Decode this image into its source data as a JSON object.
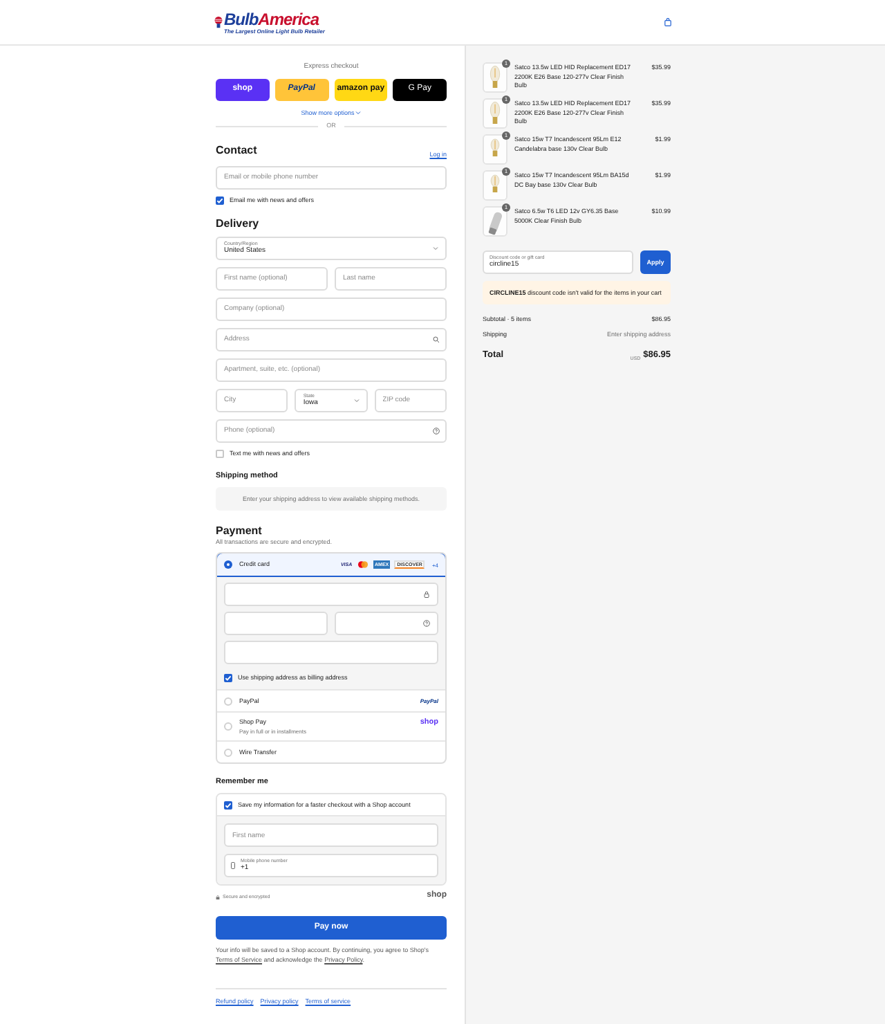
{
  "header": {
    "logo": {
      "part_1": "Bulb",
      "part_2": "America",
      "tagline": "The Largest Online Light Bulb Retailer"
    }
  },
  "express_checkout": {
    "label": "Express checkout",
    "buttons": [
      {
        "kind": "shop",
        "label": "shop"
      },
      {
        "kind": "paypal",
        "label": "PayPal"
      },
      {
        "kind": "amazon",
        "label": "amazon pay"
      },
      {
        "kind": "gpay",
        "label": "G Pay"
      }
    ],
    "more": "Show more options",
    "divider": "OR"
  },
  "contact": {
    "title": "Contact",
    "login": "Log in",
    "email": {
      "placeholder": "Email or mobile phone number"
    },
    "news": {
      "label": "Email me with news and offers",
      "checked": true
    }
  },
  "delivery": {
    "title": "Delivery",
    "country": {
      "label": "Country/Region",
      "value": "United States"
    },
    "first_name": {
      "placeholder": "First name (optional)"
    },
    "last_name": {
      "placeholder": "Last name"
    },
    "company": {
      "placeholder": "Company (optional)"
    },
    "address": {
      "placeholder": "Address"
    },
    "apartment": {
      "placeholder": "Apartment, suite, etc. (optional)"
    },
    "city": {
      "placeholder": "City"
    },
    "state": {
      "label": "State",
      "value": "Iowa"
    },
    "zip": {
      "placeholder": "ZIP code"
    },
    "phone": {
      "placeholder": "Phone (optional)"
    },
    "text_me": {
      "label": "Text me with news and offers",
      "checked": false
    }
  },
  "shipping_method": {
    "title": "Shipping method",
    "message": "Enter your shipping address to view available shipping methods."
  },
  "payment": {
    "title": "Payment",
    "subtitle": "All transactions are secure and encrypted.",
    "methods": [
      {
        "kind": "card",
        "label": "Credit card",
        "selected": true,
        "brands": [
          {
            "kind": "visa",
            "label": "VISA"
          },
          {
            "kind": "mastercard"
          },
          {
            "kind": "amex",
            "label": "AMEX"
          },
          {
            "kind": "discover",
            "label": "DISCOVER"
          }
        ],
        "more": "+4",
        "billing_same": {
          "label": "Use shipping address as billing address",
          "checked": true
        }
      },
      {
        "kind": "paypal",
        "label": "PayPal",
        "selected": false,
        "badge": "PayPal"
      },
      {
        "kind": "shoppay",
        "label": "Shop Pay",
        "sublabel": "Pay in full or in installments",
        "selected": false,
        "badge": "shop"
      },
      {
        "kind": "wire",
        "label": "Wire Transfer",
        "selected": false
      }
    ]
  },
  "remember_me": {
    "title": "Remember me",
    "save": {
      "label": "Save my information for a faster checkout with a Shop account",
      "checked": true
    },
    "first_name": {
      "placeholder": "First name"
    },
    "mobile": {
      "label": "Mobile phone number",
      "value": "+1"
    }
  },
  "secure": "Secure and encrypted",
  "shop_logo": "shop",
  "pay_button": "Pay now",
  "legal": [
    {
      "text": "Your info will be saved to a Shop account. By continuing, you agree to Shop's "
    },
    {
      "kind": "link",
      "text": "Terms of Service"
    },
    {
      "text": " and acknowledge the "
    },
    {
      "kind": "link",
      "text": "Privacy Policy"
    },
    {
      "text": "."
    }
  ],
  "footer_links": [
    "Refund policy",
    "Privacy policy",
    "Terms of service"
  ],
  "order": {
    "items": [
      {
        "quantity": "1",
        "name": "Satco 13.5w LED HID Replacement ED17 2200K E26 Base 120-277v Clear Finish Bulb",
        "price": "$35.99"
      },
      {
        "quantity": "1",
        "name": "Satco 13.5w LED HID Replacement ED17 2200K E26 Base 120-277v Clear Finish Bulb",
        "price": "$35.99"
      },
      {
        "quantity": "1",
        "name": "Satco 15w T7 Incandescent 95Lm E12 Candelabra base 130v Clear Bulb",
        "price": "$1.99"
      },
      {
        "quantity": "1",
        "name": "Satco 15w T7 Incandescent 95Lm BA15d DC Bay base 130v Clear Bulb",
        "price": "$1.99"
      },
      {
        "quantity": "1",
        "name": "Satco 6.5w T6 LED 12v GY6.35 Base 5000K Clear Finish Bulb",
        "price": "$10.99"
      }
    ],
    "discount": {
      "label": "Discount code or gift card",
      "value": "circline15"
    },
    "apply": "Apply",
    "error": "**CIRCLINE15** discount code isn't valid for the items in your cart",
    "subtotal": {
      "label": "Subtotal · 5 items",
      "value": "$86.95"
    },
    "shipping": {
      "label": "Shipping",
      "value": "Enter shipping address"
    },
    "total": {
      "label": "Total",
      "currency": "USD",
      "value": "$86.95"
    }
  }
}
